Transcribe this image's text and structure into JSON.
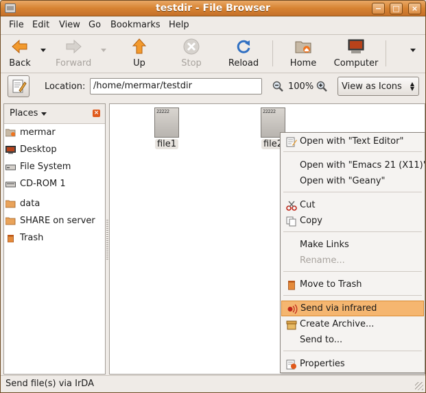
{
  "window": {
    "title": "testdir - File Browser",
    "buttons": {
      "minimize": "−",
      "maximize": "□",
      "close": "×"
    }
  },
  "menubar": {
    "items": [
      "File",
      "Edit",
      "View",
      "Go",
      "Bookmarks",
      "Help"
    ]
  },
  "toolbar": {
    "back": "Back",
    "forward": "Forward",
    "up": "Up",
    "stop": "Stop",
    "reload": "Reload",
    "home": "Home",
    "computer": "Computer"
  },
  "location": {
    "label": "Location:",
    "path": "/home/mermar/testdir",
    "zoom": "100%",
    "view_mode": "View as Icons"
  },
  "sidebar": {
    "header": "Places",
    "items": [
      {
        "label": "mermar",
        "icon": "home-folder-icon"
      },
      {
        "label": "Desktop",
        "icon": "desktop-icon"
      },
      {
        "label": "File System",
        "icon": "drive-icon"
      },
      {
        "label": "CD-ROM 1",
        "icon": "cdrom-icon"
      },
      {
        "label": "data",
        "icon": "folder-icon"
      },
      {
        "label": "SHARE on server",
        "icon": "network-folder-icon"
      },
      {
        "label": "Trash",
        "icon": "trash-icon"
      }
    ]
  },
  "files": [
    {
      "name": "file1"
    },
    {
      "name": "file2"
    }
  ],
  "context_menu": {
    "items": [
      {
        "label": "Open with \"Text Editor\"",
        "icon": "text-editor-icon",
        "disabled": false
      },
      {
        "label": "Open with \"Emacs 21 (X11)\"",
        "icon": "",
        "disabled": false
      },
      {
        "label": "Open with \"Geany\"",
        "icon": "",
        "disabled": false
      },
      {
        "label": "Cut",
        "icon": "scissors-icon",
        "disabled": false
      },
      {
        "label": "Copy",
        "icon": "copy-icon",
        "disabled": false
      },
      {
        "label": "Make Links",
        "icon": "",
        "disabled": false
      },
      {
        "label": "Rename...",
        "icon": "",
        "disabled": true
      },
      {
        "label": "Move to Trash",
        "icon": "trash-icon",
        "disabled": false
      },
      {
        "label": "Send via infrared",
        "icon": "infrared-icon",
        "disabled": false,
        "highlighted": true
      },
      {
        "label": "Create Archive...",
        "icon": "archive-icon",
        "disabled": false
      },
      {
        "label": "Send to...",
        "icon": "",
        "disabled": false
      },
      {
        "label": "Properties",
        "icon": "properties-icon",
        "disabled": false
      }
    ]
  },
  "statusbar": {
    "text": "Send file(s) via IrDA"
  },
  "colors": {
    "titlebar": "#d78332",
    "highlight": "#f5b670",
    "accent": "#e05a1c"
  }
}
